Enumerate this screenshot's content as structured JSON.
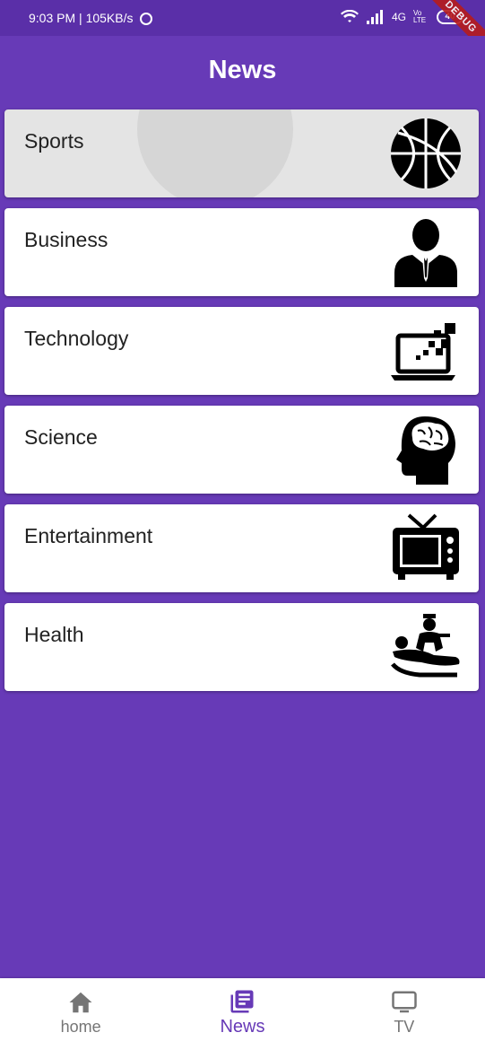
{
  "status_bar": {
    "time": "9:03 PM",
    "speed": "105KB/s",
    "network": "4G",
    "carrier_badge": "Vo LTE",
    "battery": "40",
    "debug_banner": "DEBUG"
  },
  "app_bar": {
    "title": "News"
  },
  "categories": [
    {
      "label": "Sports",
      "icon": "basketball-icon"
    },
    {
      "label": "Business",
      "icon": "businessman-icon"
    },
    {
      "label": "Technology",
      "icon": "laptop-icon"
    },
    {
      "label": "Science",
      "icon": "brain-icon"
    },
    {
      "label": "Entertainment",
      "icon": "tv-icon"
    },
    {
      "label": "Health",
      "icon": "medical-care-icon"
    }
  ],
  "bottom_nav": {
    "items": [
      {
        "label": "home",
        "icon": "home-icon",
        "active": false
      },
      {
        "label": "News",
        "icon": "news-icon",
        "active": true
      },
      {
        "label": "TV",
        "icon": "tv-monitor-icon",
        "active": false
      }
    ],
    "active_color": "#673AB7",
    "inactive_color": "#757575"
  },
  "colors": {
    "primary": "#673AB7",
    "card": "#FFFFFF",
    "pressed_card": "#E4E4E4"
  }
}
